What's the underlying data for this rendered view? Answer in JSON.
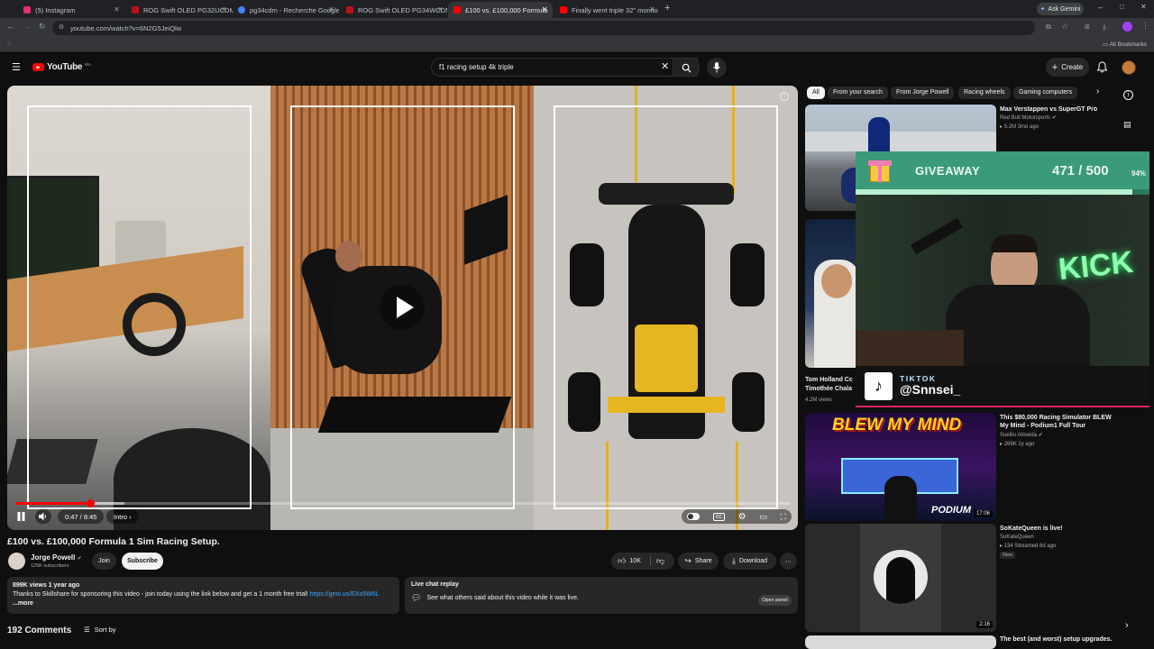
{
  "browser": {
    "tabs": [
      {
        "title": "(5) Instagram",
        "color": "#e1306c"
      },
      {
        "title": "ROG Swift OLED PG32UCDM3 |",
        "color": "#b5121b"
      },
      {
        "title": "pg34cdm - Recherche Google",
        "color": "#4285f4"
      },
      {
        "title": "ROG Swift OLED PG34WCDM |",
        "color": "#b5121b"
      },
      {
        "title": "£100 vs. £100,000 Formula",
        "color": "#ff0000"
      },
      {
        "title": "Finally went triple 32\" monitor",
        "color": "#ff0000"
      }
    ],
    "ask_gemini": "Ask Gemini",
    "url": "youtube.com/watch?v=6N2G5JeiQlw",
    "all_bookmarks": "All Bookmarks"
  },
  "header": {
    "logo": "YouTube",
    "logo_region": "MA",
    "search_query": "f1 racing setup 4k triple",
    "create_label": "Create"
  },
  "player": {
    "time": "0:47 / 8:45",
    "chapter": "Intro",
    "progress_fraction": 0.095
  },
  "chips": [
    "All",
    "From your search",
    "From Jorge Powell",
    "Racing wheels",
    "Gaming computers"
  ],
  "video": {
    "title": "£100 vs. £100,000 Formula 1 Sim Racing Setup.",
    "channel": "Jorge Powell",
    "subscribers": "125K subscribers",
    "join": "Join",
    "subscribe": "Subscribe",
    "likes": "10K",
    "share": "Share",
    "download": "Download",
    "views_date": "899K views  1 year ago",
    "description": "Thanks to Skillshare for sponsoring this video - join today using the link below and get a 1 month free trial!",
    "description_link": "https://geni.us/EXo5W6L",
    "more": "...more"
  },
  "live_chat": {
    "title": "Live chat replay",
    "text": "See what others said about this video while it was live.",
    "button": "Open panel"
  },
  "comments": {
    "count": "192 Comments",
    "sort": "Sort by"
  },
  "sidebar": [
    {
      "title": "Max Verstappen vs SuperGT Pro",
      "channel": "Red Bull Motorsports",
      "meta": "5.2M  3mo ago"
    },
    {
      "title": "Tom Holland Cc",
      "title2": "Timothée Chala",
      "meta": "4.2M views"
    },
    {
      "title": "This $80,000 Racing Simulator BLEW My Mind - Podium1 Full Tour",
      "channel": "Suellio Almeida",
      "meta": "269K  1y ago",
      "thumb_text": "BLEW MY MIND",
      "thumb_text2": "PODIUM",
      "duration": "17:06"
    },
    {
      "title": "SoKateQueen is live!",
      "channel": "SoKateQueen",
      "meta": "134  Streamed 6d ago",
      "badge": "New",
      "duration": "2:16"
    },
    {
      "title": "The best (and worst) setup upgrades."
    }
  ],
  "overlay": {
    "giveaway_label": "GIVEAWAY",
    "giveaway_count": "471",
    "giveaway_total": "/ 500",
    "giveaway_pct": "94%",
    "tiktok_label": "TIKTOK",
    "tiktok_handle": "@Snnsei_",
    "neon_text": "KICK"
  },
  "colors": {
    "accent": "#ff0000",
    "giveaway_bg": "#3b9a7a",
    "link": "#3ea6ff"
  }
}
